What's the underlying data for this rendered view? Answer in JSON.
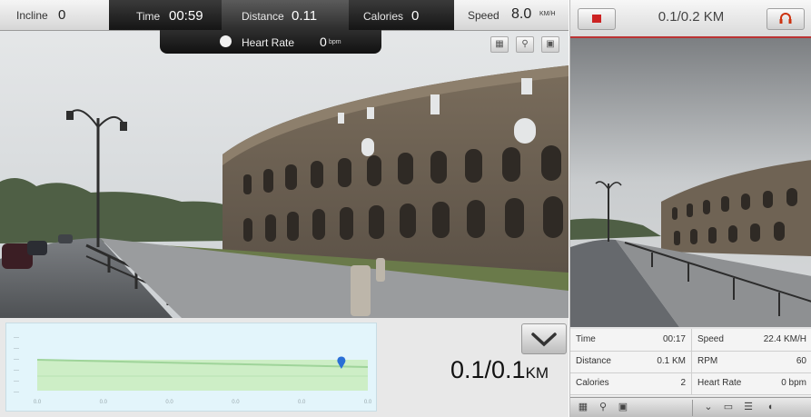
{
  "workout_bar": {
    "incline_label": "Incline",
    "incline_value": "0",
    "time_label": "Time",
    "time_value": "00:59",
    "distance_label": "Distance",
    "distance_value": "0.11",
    "calories_label": "Calories",
    "calories_value": "0",
    "speed_label": "Speed",
    "speed_value": "8.0",
    "speed_unit": "KM/H",
    "heart_rate_label": "Heart Rate",
    "heart_rate_value": "0",
    "heart_rate_unit": "bpm"
  },
  "view_tools": [
    "map-icon",
    "street-view-icon",
    "layers-icon"
  ],
  "distance_display": {
    "value": "0.1/0.1",
    "unit": "KM"
  },
  "elevation_profile": {
    "progress": 0.92,
    "tick_labels": [
      "0.0",
      "0.0",
      "0.0",
      "0.0",
      "0.0",
      "0.0"
    ]
  },
  "right_panel": {
    "title": "0.1/0.2 KM",
    "record_icon": "stop-icon",
    "headphones_icon": "headphones-icon",
    "stats": [
      {
        "label": "Time",
        "value": "00:17"
      },
      {
        "label": "Speed",
        "value": "22.4 KM/H"
      },
      {
        "label": "Distance",
        "value": "0.1 KM"
      },
      {
        "label": "RPM",
        "value": "60"
      },
      {
        "label": "Calories",
        "value": "2"
      },
      {
        "label": "Heart Rate",
        "value": "0 bpm"
      }
    ],
    "footer_icons": [
      "map-icon",
      "street-view-icon",
      "layers-icon",
      "chevron-down-icon",
      "window-icon",
      "list-icon",
      "speaker-icon"
    ]
  },
  "colors": {
    "accent_red": "#cc2222",
    "chart_bg": "#e3f5fb",
    "chart_line": "#9fd49a",
    "marker": "#2a6fd6"
  }
}
